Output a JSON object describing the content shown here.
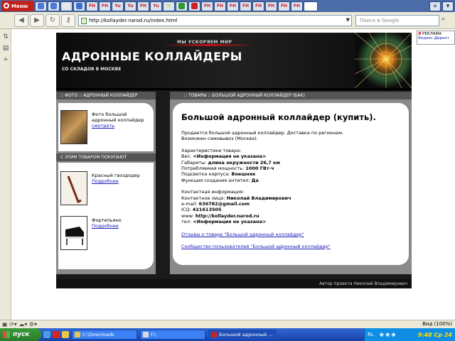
{
  "browser": {
    "menu_label": "Меню",
    "tabs": [
      {
        "label": "",
        "color": "#4a7bd8"
      },
      {
        "label": "",
        "color": "#4a7bd8"
      },
      {
        "label": "",
        "color": "#e8e8e8"
      },
      {
        "label": "",
        "color": "#3b6fd3"
      },
      {
        "label": "FH",
        "color": "#c22"
      },
      {
        "label": "FH",
        "color": "#c22"
      },
      {
        "label": "Yu",
        "color": "#c22"
      },
      {
        "label": "Yu",
        "color": "#c22"
      },
      {
        "label": "FH",
        "color": "#c22"
      },
      {
        "label": "Yu",
        "color": "#c22"
      },
      {
        "label": "☢",
        "color": "#e6c800"
      },
      {
        "label": "",
        "color": "#2e9a2e"
      },
      {
        "label": "",
        "color": "#c22"
      },
      {
        "label": "FH",
        "color": "#c22"
      },
      {
        "label": "FH",
        "color": "#c22"
      },
      {
        "label": "FH",
        "color": "#c22"
      },
      {
        "label": "FH",
        "color": "#c22"
      },
      {
        "label": "FH",
        "color": "#c22"
      },
      {
        "label": "FH",
        "color": "#c22"
      },
      {
        "label": "FH",
        "color": "#c22"
      },
      {
        "label": "FH",
        "color": "#c22"
      },
      {
        "label": "",
        "color": "#fff"
      }
    ],
    "address": "http://kollayder.narod.ru/index.html",
    "search_placeholder": "Поиск в Google",
    "zoom": "Вид (100%)"
  },
  "yandex_widget": {
    "ads_label": "РЕКЛАМА",
    "links": "Яндекс.Директ"
  },
  "site": {
    "slogan": "МЫ УСКОРЯЕМ МИР",
    "title": "АДРОННЫЕ КОЛЛАЙДЕРЫ",
    "subtitle": "СО СКЛАДОВ В МОСКВЕ",
    "left_head1": ":: ФОТО :: АДРОННЫЙ КОЛЛАЙДЕР",
    "photo_text": "Фото большой адронный коллайдер",
    "photo_link": "смотреть",
    "left_head2": "С ЭТИМ ТОВАРОМ ПОКУПАЮТ",
    "related": [
      {
        "name": "Красный гвоздодер",
        "link": "Подробнее"
      },
      {
        "name": "Фортепьяно",
        "link": "Подробнее"
      }
    ],
    "right_head": ":: ТОВАРЫ :: БОЛЬШОЙ АДРОННЫЙ КОЛЛАЙДЕР (БАК)",
    "product_title": "Большой адронный коллайдер (купить).",
    "intro": [
      "Продается большой адронный коллайдер. Доставка по регионам.",
      "Возможен самовывоз (Москва)."
    ],
    "specs_title": "Характеристики товара:",
    "specs": [
      {
        "k": "Вес:",
        "v": "<Информация не указана>"
      },
      {
        "k": "Габариты:",
        "v": "длина окружности 26,7 км"
      },
      {
        "k": "Потребляемая мощность:",
        "v": "1000 ГВт·ч"
      },
      {
        "k": "Подсветка корпуса:",
        "v": "Внешняя"
      },
      {
        "k": "Функция создания антител:",
        "v": "Да"
      }
    ],
    "contact_title": "Контактная информация:",
    "contacts": [
      {
        "k": "Контактное лицо:",
        "v": "Николай Владимирович"
      },
      {
        "k": "e-mail:",
        "v": "636782@gmail.com"
      },
      {
        "k": "ICQ:",
        "v": "421613505"
      },
      {
        "k": "www:",
        "v": "http://kollayder.narod.ru"
      },
      {
        "k": "тел:",
        "v": "<Информация не указана>"
      }
    ],
    "link1": "Отзывы о товаре \"Большой адронный коллайдер\"",
    "link2": "Сообщество пользователей \"Большой адронный коллайдер\"",
    "footer": "Автор проекта Николай Владимирович"
  },
  "taskbar": {
    "start": "пуск",
    "tasks": [
      {
        "label": "C:\\Downloads",
        "color": "#e8c64a"
      },
      {
        "label": "F:\\",
        "color": "#dcdcdc"
      },
      {
        "label": "Большой адронный ...",
        "color": "#c22",
        "active": true
      }
    ],
    "lang": "RL",
    "clock": "9:48 Ср 24"
  }
}
